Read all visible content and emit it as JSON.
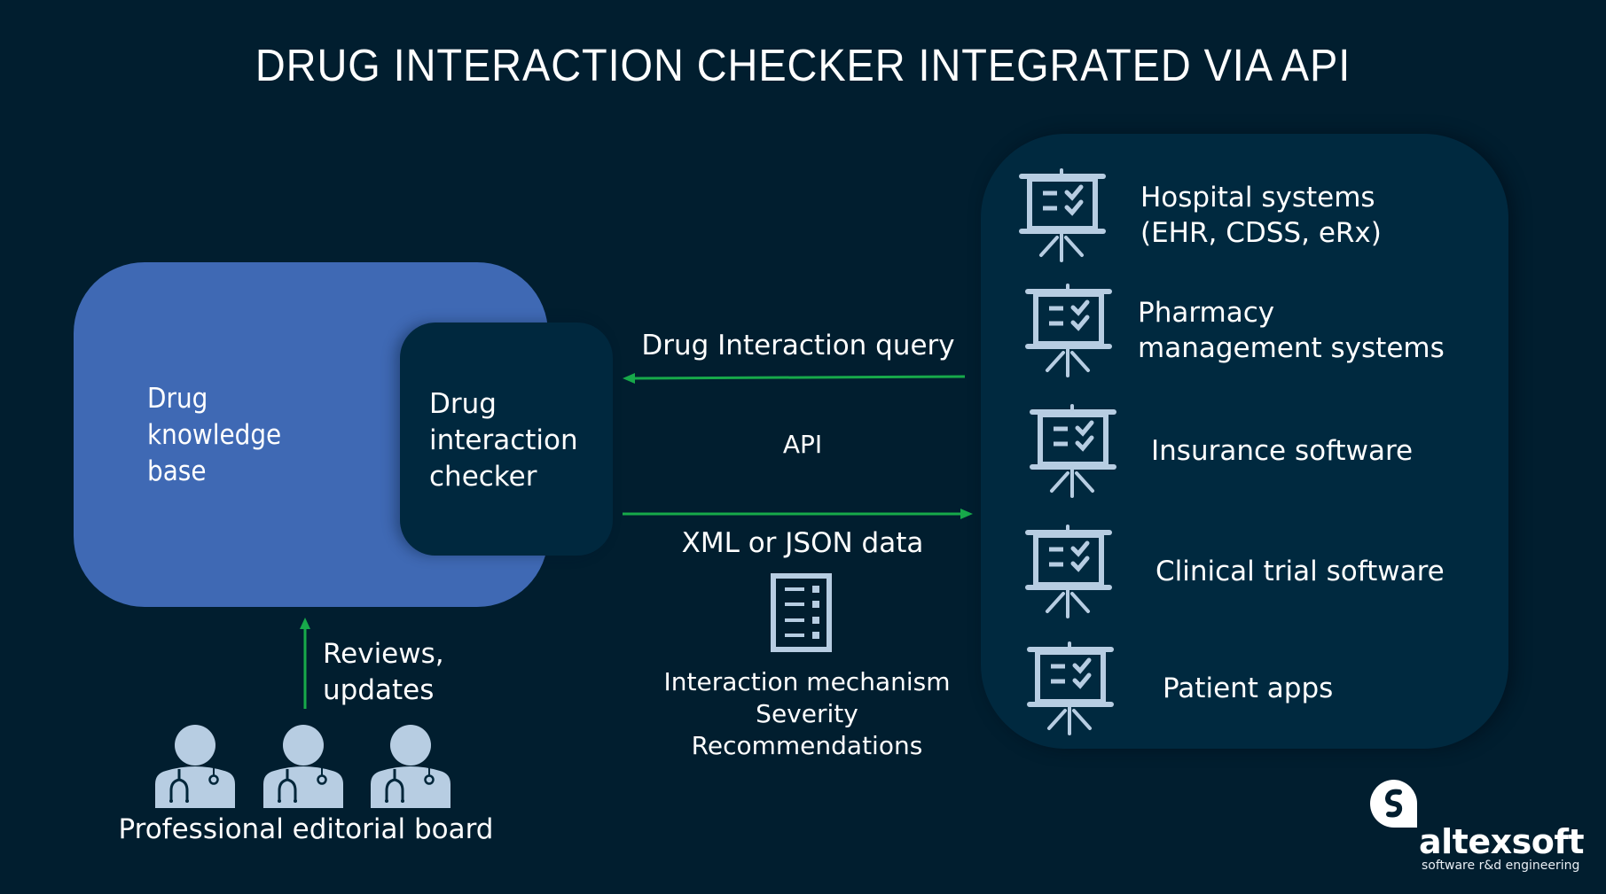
{
  "title": "DRUG INTERACTION CHECKER INTEGRATED VIA API",
  "knowledge_base": {
    "label_lines": [
      "Drug",
      "knowledge",
      "base"
    ]
  },
  "checker": {
    "label_lines": [
      "Drug",
      "interaction",
      "checker"
    ]
  },
  "api": {
    "query_label": "Drug Interaction query",
    "api_label": "API",
    "response_label": "XML or JSON data",
    "response_icon": "document-list-icon",
    "details": [
      "Interaction mechanism",
      "Severity",
      "Recommendations"
    ]
  },
  "targets": [
    {
      "lines": [
        "Hospital systems",
        "(EHR, CDSS, eRx)"
      ],
      "icon": "presentation-board-icon"
    },
    {
      "lines": [
        "Pharmacy",
        "management systems"
      ],
      "icon": "presentation-board-icon"
    },
    {
      "lines": [
        "Insurance software"
      ],
      "icon": "presentation-board-icon"
    },
    {
      "lines": [
        "Clinical trial software"
      ],
      "icon": "presentation-board-icon"
    },
    {
      "lines": [
        "Patient apps"
      ],
      "icon": "presentation-board-icon"
    }
  ],
  "editorial": {
    "arrow_label_lines": [
      "Reviews,",
      "updates"
    ],
    "board_label": "Professional editorial board",
    "member_icon": "doctor-icon",
    "member_count": 3
  },
  "logo": {
    "name": "altexsoft",
    "tagline": "software r&d engineering"
  },
  "colors": {
    "background": "#011e2f",
    "knowledge_base": "#3f69b4",
    "panel": "#00293f",
    "arrow": "#17a94a",
    "icon": "#b7cde2",
    "text": "#ffffff"
  }
}
